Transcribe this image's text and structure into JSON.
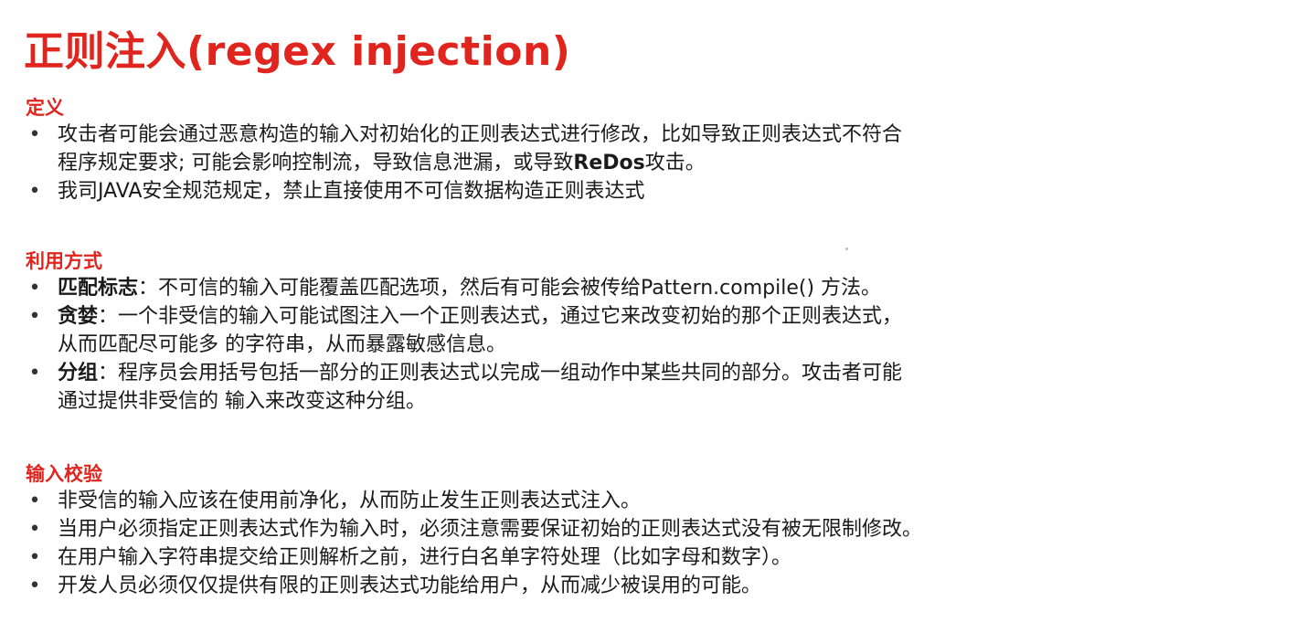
{
  "title": "正则注入(regex injection)",
  "sections": [
    {
      "heading": "定义",
      "items": [
        {
          "line1": "攻击者可能会通过恶意构造的输入对初始化的正则表达式进行修改，比如导致正则表达式不符合",
          "line2_pre": "程序规定要求; 可能会影响控制流，导致信息泄漏，或导致",
          "line2_bold": "ReDos",
          "line2_post": "攻击。"
        },
        {
          "text": "我司JAVA安全规范规定，禁止直接使用不可信数据构造正则表达式"
        }
      ]
    },
    {
      "heading": "利用方式",
      "items": [
        {
          "term": "匹配标志",
          "sep": "：",
          "line1": "不可信的输入可能覆盖匹配选项，然后有可能会被传给Pattern.compile() 方法。"
        },
        {
          "term": "贪婪",
          "sep": "：",
          "line1": "一个非受信的输入可能试图注入一个正则表达式，通过它来改变初始的那个正则表达式，",
          "line2": "从而匹配尽可能多 的字符串，从而暴露敏感信息。"
        },
        {
          "term": "分组",
          "sep": "：",
          "line1": "程序员会用括号包括一部分的正则表达式以完成一组动作中某些共同的部分。攻击者可能",
          "line2": "通过提供非受信的 输入来改变这种分组。"
        }
      ]
    },
    {
      "heading": "输入校验",
      "items": [
        {
          "text": "非受信的输入应该在使用前净化，从而防止发生正则表达式注入。"
        },
        {
          "text": "当用户必须指定正则表达式作为输入时，必须注意需要保证初始的正则表达式没有被无限制修改。"
        },
        {
          "text": "在用户输入字符串提交给正则解析之前，进行白名单字符处理（比如字母和数字）。"
        },
        {
          "text": "开发人员必须仅仅提供有限的正则表达式功能给用户，从而减少被误用的可能。"
        }
      ]
    }
  ],
  "bullet_glyph": "•",
  "colors": {
    "accent": "#e0251f",
    "text": "#1a1a1a",
    "background": "#ffffff"
  }
}
